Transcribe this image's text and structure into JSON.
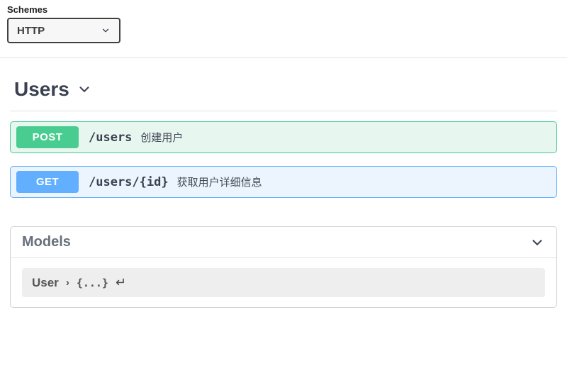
{
  "schemes": {
    "label": "Schemes",
    "selected": "HTTP"
  },
  "tag": {
    "name": "Users"
  },
  "operations": [
    {
      "method": "POST",
      "method_class": "post",
      "path": "/users",
      "summary": "创建用户"
    },
    {
      "method": "GET",
      "method_class": "get",
      "path": "/users/{id}",
      "summary": "获取用户详细信息"
    }
  ],
  "models": {
    "header": "Models",
    "items": [
      {
        "name": "User",
        "collapsed_repr": "{...}"
      }
    ]
  }
}
